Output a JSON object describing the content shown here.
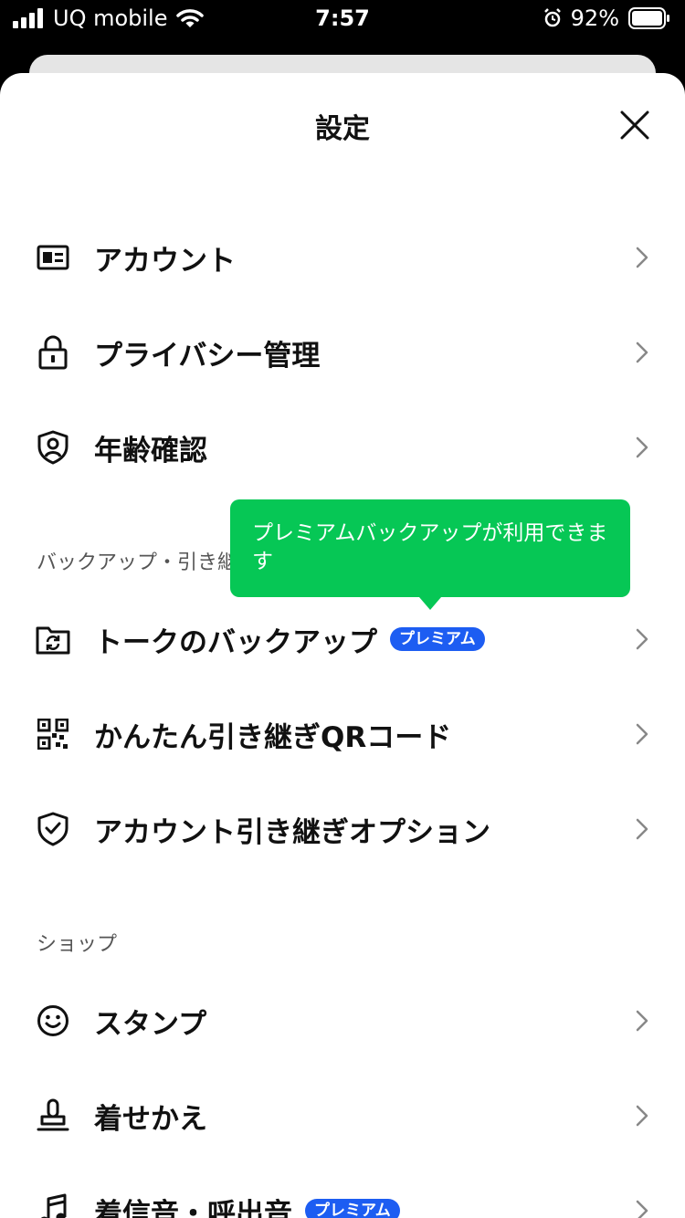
{
  "status_bar": {
    "carrier": "UQ mobile",
    "time": "7:57",
    "battery": "92%"
  },
  "header": {
    "title": "設定"
  },
  "rows": {
    "account": "アカウント",
    "privacy": "プライバシー管理",
    "age": "年齢確認",
    "backup": "トークのバックアップ",
    "qr": "かんたん引き継ぎQRコード",
    "transfer": "アカウント引き継ぎオプション",
    "stamp": "スタンプ",
    "theme": "着せかえ",
    "ringtone": "着信音・呼出音"
  },
  "badges": {
    "backup": "プレミアム",
    "ringtone": "プレミアム"
  },
  "sections": {
    "backup": "バックアップ・引き継ぎ",
    "shop": "ショップ"
  },
  "tooltip": {
    "text": "プレミアムバックアップが利用できます"
  },
  "colors": {
    "accent_green": "#06c755",
    "badge_blue": "#1d5df2"
  }
}
